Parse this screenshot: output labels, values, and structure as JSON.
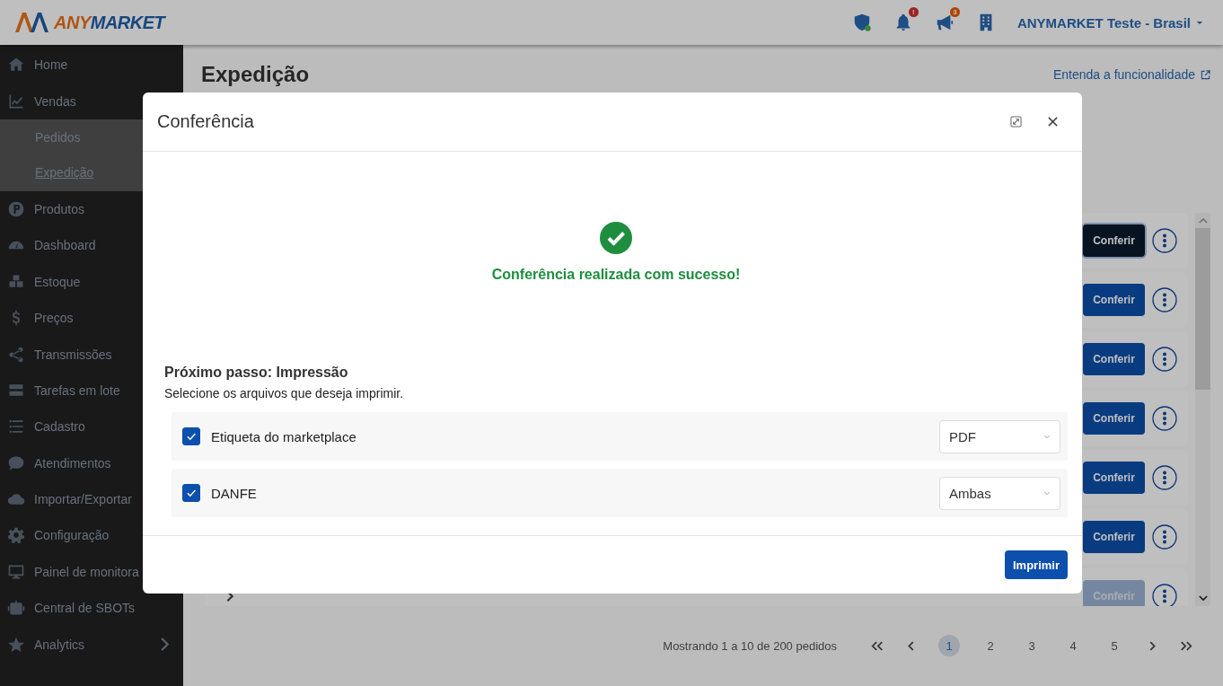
{
  "brand": {
    "prefix": "ANY",
    "suffix": "MARKET"
  },
  "topbar": {
    "notifications_badge": "!",
    "announcements_badge": "3",
    "account": "ANYMARKET Teste - Brasil"
  },
  "sidebar": {
    "items": [
      {
        "label": "Home",
        "selected": false
      },
      {
        "label": "Vendas",
        "selected": false,
        "expanded": true,
        "children": [
          {
            "label": "Pedidos",
            "selected": false
          },
          {
            "label": "Expedição",
            "selected": true
          }
        ]
      },
      {
        "label": "Produtos",
        "selected": false
      },
      {
        "label": "Dashboard",
        "selected": false
      },
      {
        "label": "Estoque",
        "selected": false
      },
      {
        "label": "Preços",
        "selected": false
      },
      {
        "label": "Transmissões",
        "selected": false
      },
      {
        "label": "Tarefas em lote",
        "selected": false
      },
      {
        "label": "Cadastro",
        "selected": false
      },
      {
        "label": "Atendimentos",
        "selected": false
      },
      {
        "label": "Importar/Exportar",
        "selected": false
      },
      {
        "label": "Configuração",
        "selected": false
      },
      {
        "label": "Painel de monitora",
        "selected": false
      },
      {
        "label": "Central de SBOTs",
        "selected": false
      },
      {
        "label": "Analytics",
        "selected": false,
        "expanded": false
      }
    ]
  },
  "page": {
    "title": "Expedição",
    "help_link": "Entenda a funcionalidade"
  },
  "orders": {
    "rows": [
      {
        "button": "Conferir",
        "focused": true,
        "disabled": false
      },
      {
        "button": "Conferir",
        "focused": false,
        "disabled": false
      },
      {
        "button": "Conferir",
        "focused": false,
        "disabled": false
      },
      {
        "button": "Conferir",
        "focused": false,
        "disabled": false
      },
      {
        "button": "Conferir",
        "focused": false,
        "disabled": false
      },
      {
        "button": "Conferir",
        "focused": false,
        "disabled": false
      },
      {
        "button": "Conferir",
        "focused": false,
        "disabled": true,
        "expanded": false
      }
    ]
  },
  "pagination": {
    "summary": "Mostrando 1 a 10 de 200 pedidos",
    "pages": [
      {
        "label": "1",
        "selected": true
      },
      {
        "label": "2",
        "selected": false
      },
      {
        "label": "3",
        "selected": false
      },
      {
        "label": "4",
        "selected": false
      },
      {
        "label": "5",
        "selected": false
      }
    ]
  },
  "modal": {
    "title": "Conferência",
    "message": "Conferência realizada com sucesso!",
    "next_step": "Próximo passo: Impressão",
    "instruction": "Selecione os arquivos que deseja imprimir.",
    "files": [
      {
        "label": "Etiqueta do marketplace",
        "checked": true,
        "format": "PDF"
      },
      {
        "label": "DANFE",
        "checked": true,
        "format": "Ambas"
      }
    ],
    "print_button": "Imprimir"
  }
}
